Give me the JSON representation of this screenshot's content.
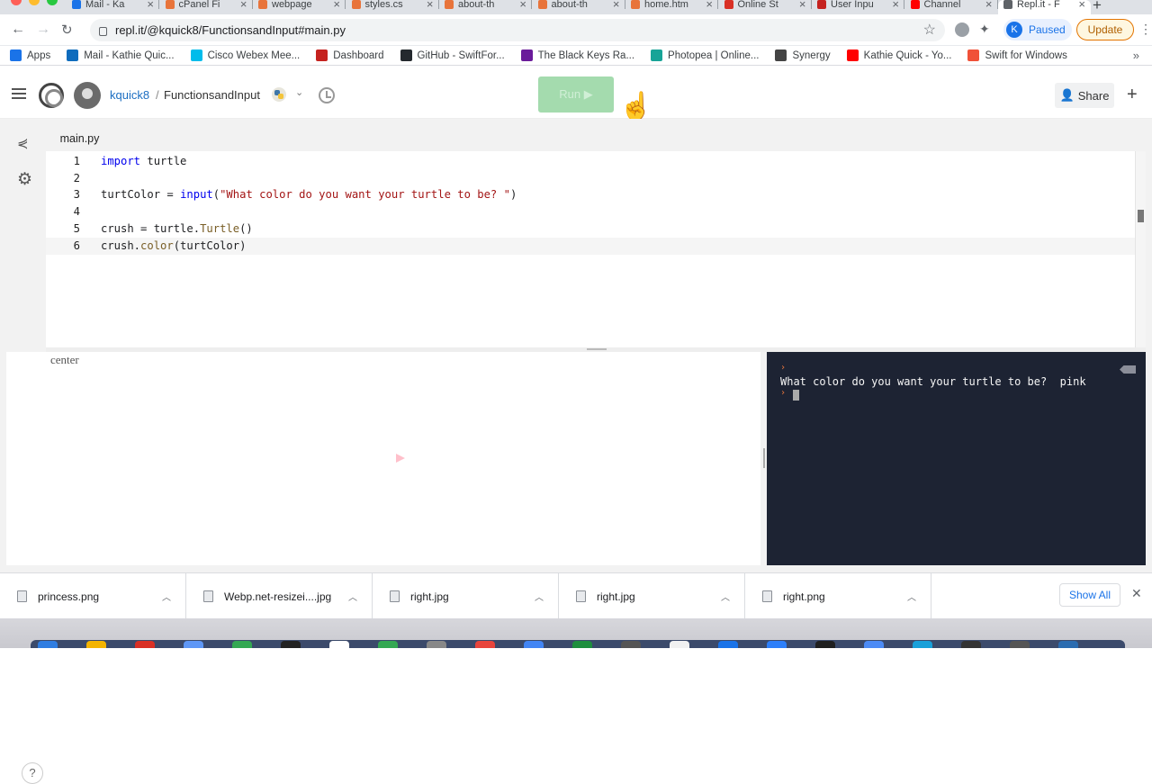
{
  "browser": {
    "tabs": [
      {
        "title": "Mail - Ka",
        "color": "#1a73e8"
      },
      {
        "title": "cPanel Fi",
        "color": "#e8743b"
      },
      {
        "title": "webpage",
        "color": "#e8743b"
      },
      {
        "title": "styles.cs",
        "color": "#e8743b"
      },
      {
        "title": "about-th",
        "color": "#e8743b"
      },
      {
        "title": "about-th",
        "color": "#e8743b"
      },
      {
        "title": "home.htm",
        "color": "#e8743b"
      },
      {
        "title": "Online St",
        "color": "#d93025"
      },
      {
        "title": "User Inpu",
        "color": "#c5221f"
      },
      {
        "title": "Channel",
        "color": "#ff0000"
      },
      {
        "title": "Repl.it - F",
        "color": "#5f6368",
        "active": true
      }
    ],
    "url": "repl.it/@kquick8/FunctionsandInput#main.py",
    "profile_initial": "K",
    "profile_status": "Paused",
    "update_label": "Update",
    "bookmarks": [
      {
        "label": "Apps",
        "color": "#1a73e8"
      },
      {
        "label": "Mail - Kathie Quic...",
        "color": "#0f6cbd"
      },
      {
        "label": "Cisco Webex Mee...",
        "color": "#00bceb"
      },
      {
        "label": "Dashboard",
        "color": "#c5221f"
      },
      {
        "label": "GitHub - SwiftFor...",
        "color": "#24292e"
      },
      {
        "label": "The Black Keys Ra...",
        "color": "#6a1b9a"
      },
      {
        "label": "Photopea | Online...",
        "color": "#18a497"
      },
      {
        "label": "Synergy",
        "color": "#444444"
      },
      {
        "label": "Kathie Quick - Yo...",
        "color": "#ff0000"
      },
      {
        "label": "Swift for Windows",
        "color": "#f05138"
      }
    ]
  },
  "repl": {
    "username": "kquick8",
    "separator": "/",
    "project": "FunctionsandInput",
    "run_label": "Run ▶",
    "share_label": "Share",
    "file_tab": "main.py",
    "code_lines": [
      {
        "num": "1",
        "tokens": [
          {
            "t": "import",
            "c": "kw"
          },
          {
            "t": " turtle",
            "c": ""
          }
        ]
      },
      {
        "num": "2",
        "tokens": []
      },
      {
        "num": "3",
        "tokens": [
          {
            "t": "turtColor = ",
            "c": ""
          },
          {
            "t": "input",
            "c": "kw"
          },
          {
            "t": "(",
            "c": ""
          },
          {
            "t": "\"What color do you want your turtle to be? \"",
            "c": "str"
          },
          {
            "t": ")",
            "c": ""
          }
        ]
      },
      {
        "num": "4",
        "tokens": []
      },
      {
        "num": "5",
        "tokens": [
          {
            "t": "crush = turtle.",
            "c": ""
          },
          {
            "t": "Turtle",
            "c": "fn"
          },
          {
            "t": "()",
            "c": ""
          }
        ]
      },
      {
        "num": "6",
        "tokens": [
          {
            "t": "crush.",
            "c": ""
          },
          {
            "t": "color",
            "c": "fn"
          },
          {
            "t": "(turtColor)",
            "c": ""
          }
        ],
        "current": true
      }
    ],
    "canvas_label": "center",
    "turtle_color": "#ffc0cb",
    "console_prompt": "›",
    "console_output": "What color do you want your turtle to be?  pink",
    "help_label": "?"
  },
  "downloads": {
    "items": [
      "princess.png",
      "Webp.net-resizei....jpg",
      "right.jpg",
      "right.jpg",
      "right.png"
    ],
    "show_all_label": "Show All"
  },
  "dock": {
    "icon_colors": [
      "#2f7de1",
      "#f4b400",
      "#d93025",
      "#5e97f6",
      "#34a853",
      "#222222",
      "#ffffff",
      "#34a853",
      "#888888",
      "#e8453c",
      "#4285f4",
      "#1e8e3e",
      "#555555",
      "#f1f1f1",
      "#1a73e8",
      "#2d7ff9",
      "#1f1f1f",
      "#4c8bf5",
      "#19a0d9",
      "#333333",
      "#555555",
      "#2b6cb0"
    ]
  }
}
